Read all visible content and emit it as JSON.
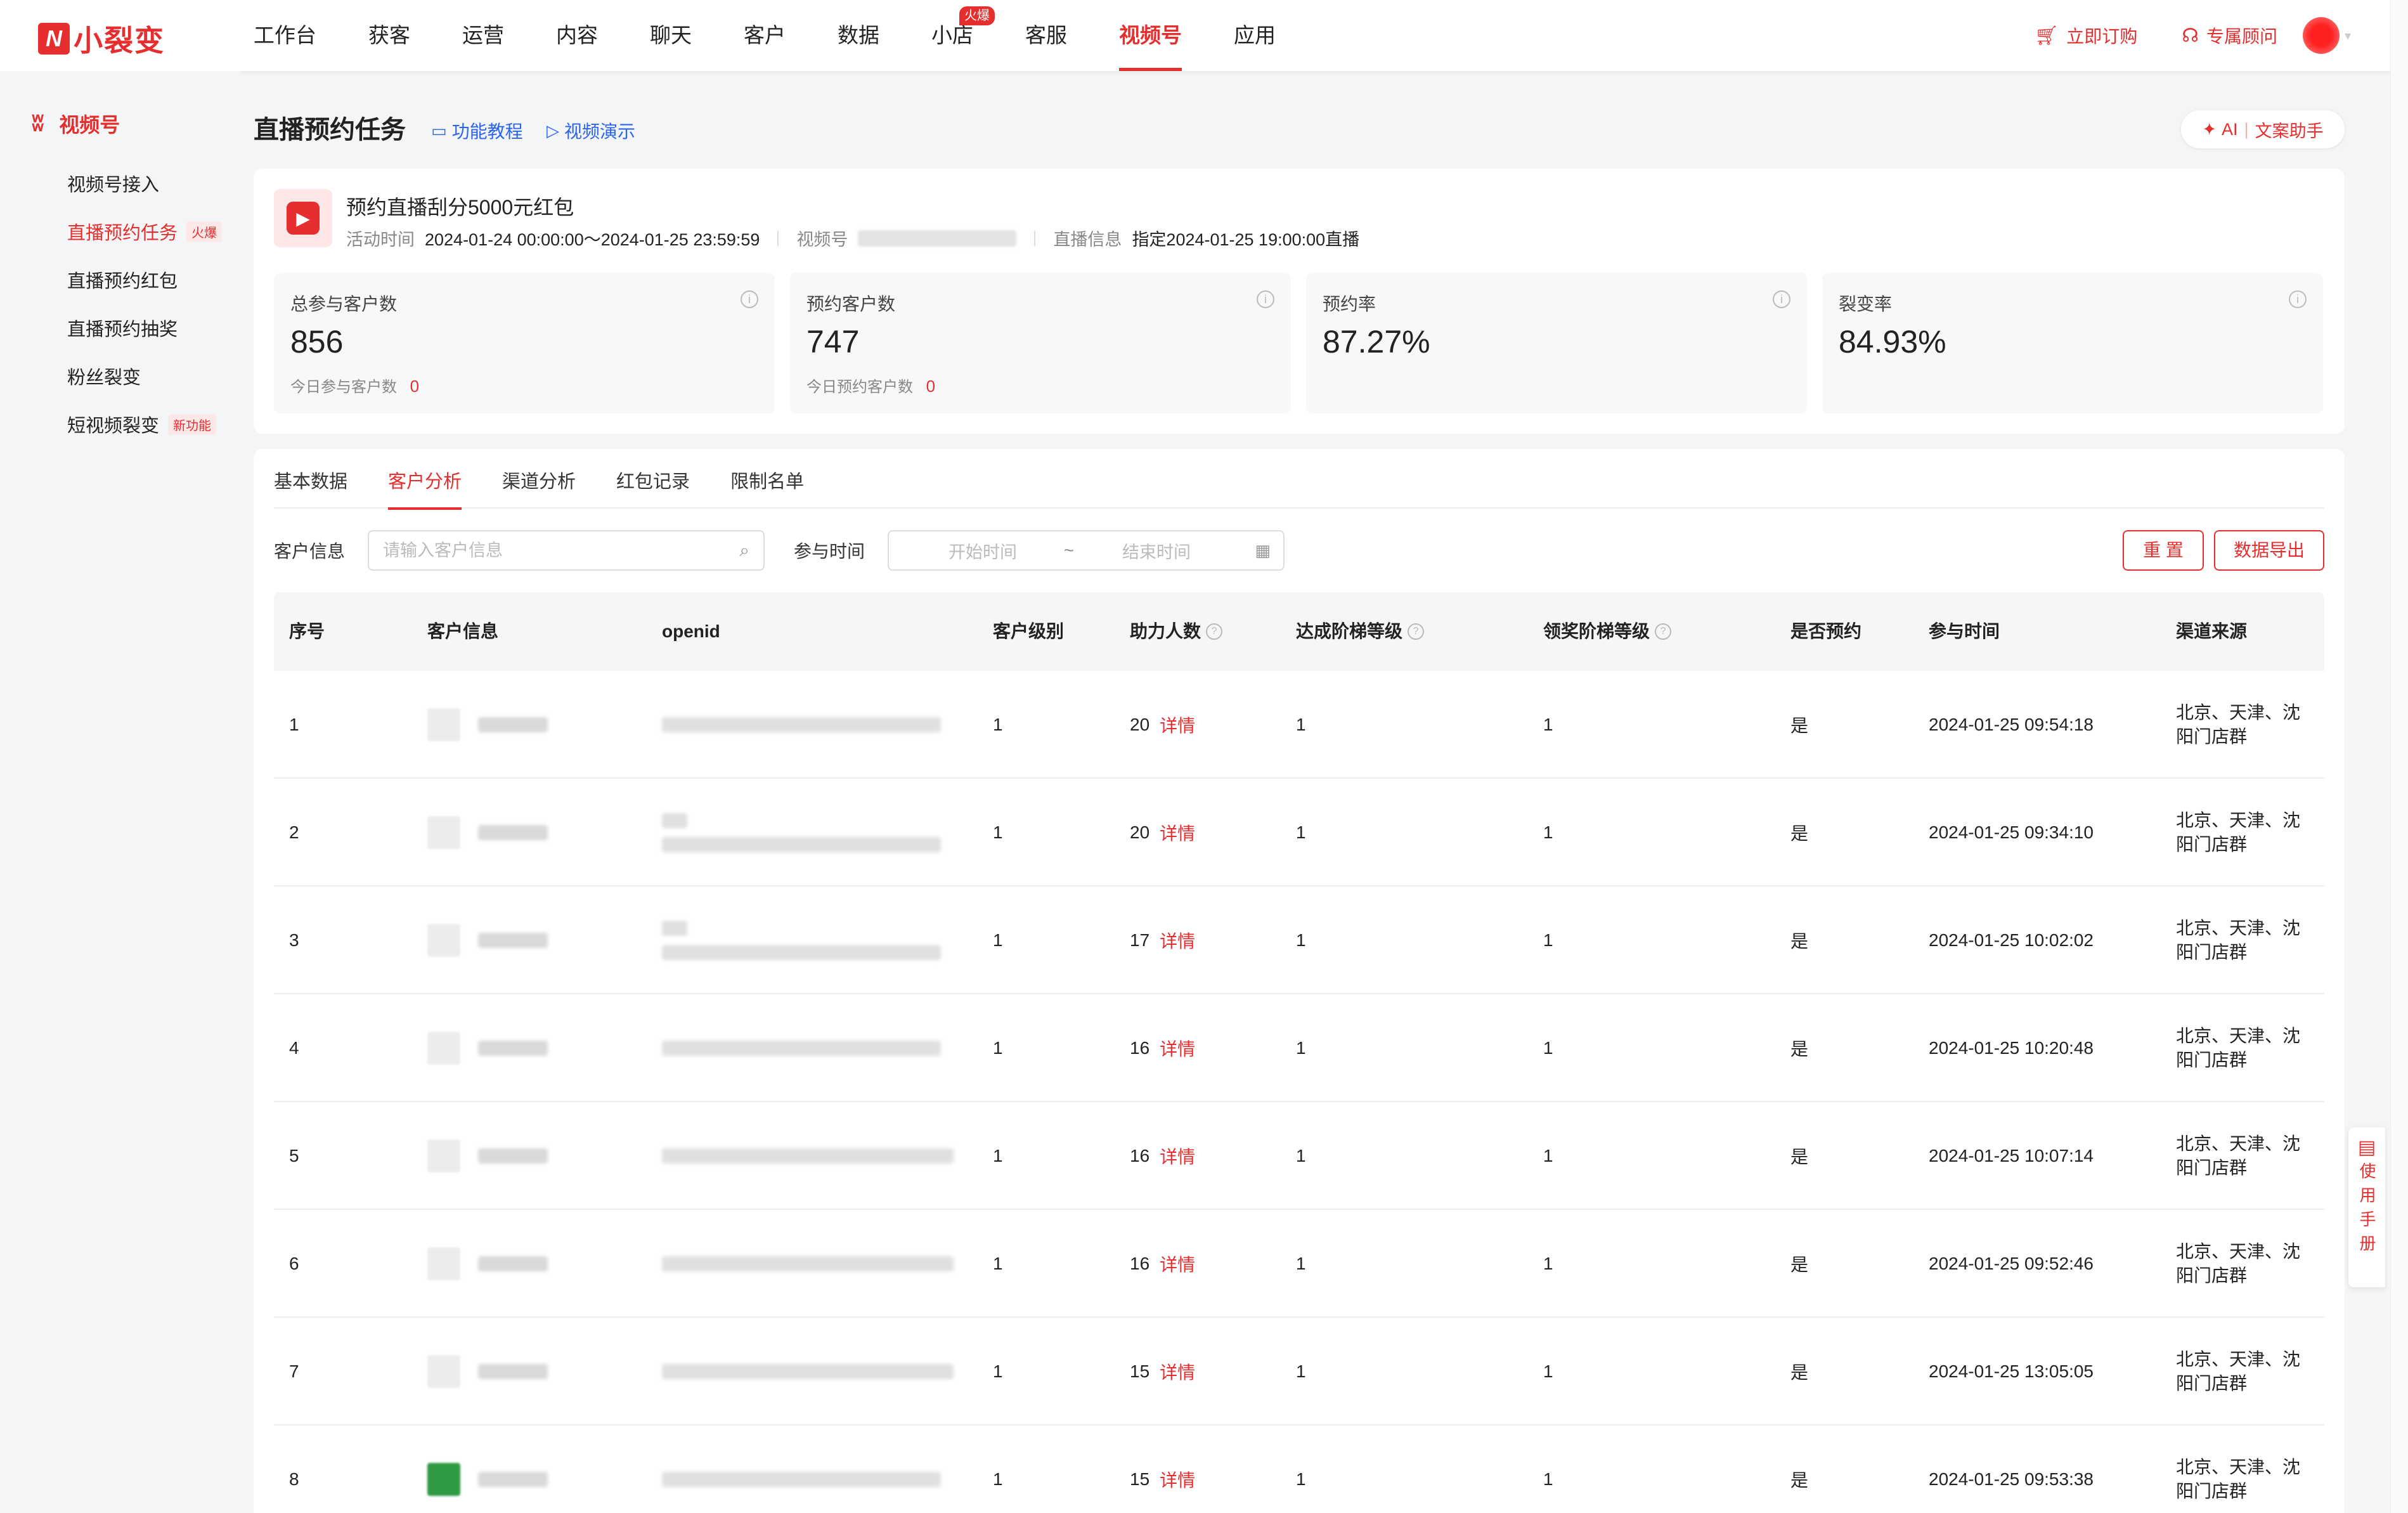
{
  "brand": {
    "name": "小裂变"
  },
  "nav": {
    "items": [
      {
        "label": "工作台"
      },
      {
        "label": "获客"
      },
      {
        "label": "运营"
      },
      {
        "label": "内容"
      },
      {
        "label": "聊天"
      },
      {
        "label": "客户"
      },
      {
        "label": "数据"
      },
      {
        "label": "小店",
        "badge": "火爆"
      },
      {
        "label": "客服"
      },
      {
        "label": "视频号",
        "active": true
      },
      {
        "label": "应用"
      }
    ],
    "subscribe": "立即订购",
    "advisor": "专属顾问"
  },
  "sidebar": {
    "title": "视频号",
    "items": [
      {
        "label": "视频号接入"
      },
      {
        "label": "直播预约任务",
        "tag": "火爆",
        "active": true
      },
      {
        "label": "直播预约红包"
      },
      {
        "label": "直播预约抽奖"
      },
      {
        "label": "粉丝裂变"
      },
      {
        "label": "短视频裂变",
        "tag": "新功能"
      }
    ]
  },
  "header": {
    "title": "直播预约任务",
    "tutorial": "功能教程",
    "video_demo": "视频演示",
    "ai_label": "AI",
    "ai_assistant": "文案助手"
  },
  "task": {
    "name": "预约直播刮分5000元红包",
    "time_label": "活动时间",
    "time_value": "2024-01-24 00:00:00～2024-01-25 23:59:59",
    "channel_label": "视频号",
    "live_label": "直播信息",
    "live_value": "指定2024-01-25 19:00:00直播"
  },
  "stats": [
    {
      "label": "总参与客户数",
      "value": "856",
      "sub_label": "今日参与客户数",
      "sub_value": "0"
    },
    {
      "label": "预约客户数",
      "value": "747",
      "sub_label": "今日预约客户数",
      "sub_value": "0"
    },
    {
      "label": "预约率",
      "value": "87.27%"
    },
    {
      "label": "裂变率",
      "value": "84.93%"
    }
  ],
  "tabs": [
    {
      "label": "基本数据"
    },
    {
      "label": "客户分析",
      "active": true
    },
    {
      "label": "渠道分析"
    },
    {
      "label": "红包记录"
    },
    {
      "label": "限制名单"
    }
  ],
  "filters": {
    "customer_label": "客户信息",
    "customer_placeholder": "请输入客户信息",
    "time_label": "参与时间",
    "start_placeholder": "开始时间",
    "separator": "~",
    "end_placeholder": "结束时间",
    "reset": "重 置",
    "export": "数据导出"
  },
  "table": {
    "columns": [
      "序号",
      "客户信息",
      "openid",
      "客户级别",
      "助力人数",
      "达成阶梯等级",
      "领奖阶梯等级",
      "是否预约",
      "参与时间",
      "渠道来源"
    ],
    "detail_label": "详情",
    "rows": [
      {
        "idx": "1",
        "level": "1",
        "helpers": "20",
        "reach": "1",
        "claim": "1",
        "reserved": "是",
        "time": "2024-01-25 09:54:18",
        "source1": "北京、天津、沈",
        "source2": "阳门店群"
      },
      {
        "idx": "2",
        "level": "1",
        "helpers": "20",
        "reach": "1",
        "claim": "1",
        "reserved": "是",
        "time": "2024-01-25 09:34:10",
        "source1": "北京、天津、沈",
        "source2": "阳门店群"
      },
      {
        "idx": "3",
        "level": "1",
        "helpers": "17",
        "reach": "1",
        "claim": "1",
        "reserved": "是",
        "time": "2024-01-25 10:02:02",
        "source1": "北京、天津、沈",
        "source2": "阳门店群"
      },
      {
        "idx": "4",
        "level": "1",
        "helpers": "16",
        "reach": "1",
        "claim": "1",
        "reserved": "是",
        "time": "2024-01-25 10:20:48",
        "source1": "北京、天津、沈",
        "source2": "阳门店群"
      },
      {
        "idx": "5",
        "level": "1",
        "helpers": "16",
        "reach": "1",
        "claim": "1",
        "reserved": "是",
        "time": "2024-01-25 10:07:14",
        "source1": "北京、天津、沈",
        "source2": "阳门店群"
      },
      {
        "idx": "6",
        "level": "1",
        "helpers": "16",
        "reach": "1",
        "claim": "1",
        "reserved": "是",
        "time": "2024-01-25 09:52:46",
        "source1": "北京、天津、沈",
        "source2": "阳门店群"
      },
      {
        "idx": "7",
        "level": "1",
        "helpers": "15",
        "reach": "1",
        "claim": "1",
        "reserved": "是",
        "time": "2024-01-25 13:05:05",
        "source1": "北京、天津、沈",
        "source2": "阳门店群"
      },
      {
        "idx": "8",
        "level": "1",
        "helpers": "15",
        "reach": "1",
        "claim": "1",
        "reserved": "是",
        "time": "2024-01-25 09:53:38",
        "source1": "北京、天津、沈",
        "source2": "阳门店群"
      }
    ]
  },
  "manual": {
    "label": "使用手册"
  },
  "colors": {
    "accent": "#e62e2e",
    "link": "#2a64f0",
    "page_bg": "#f4f5f7"
  }
}
